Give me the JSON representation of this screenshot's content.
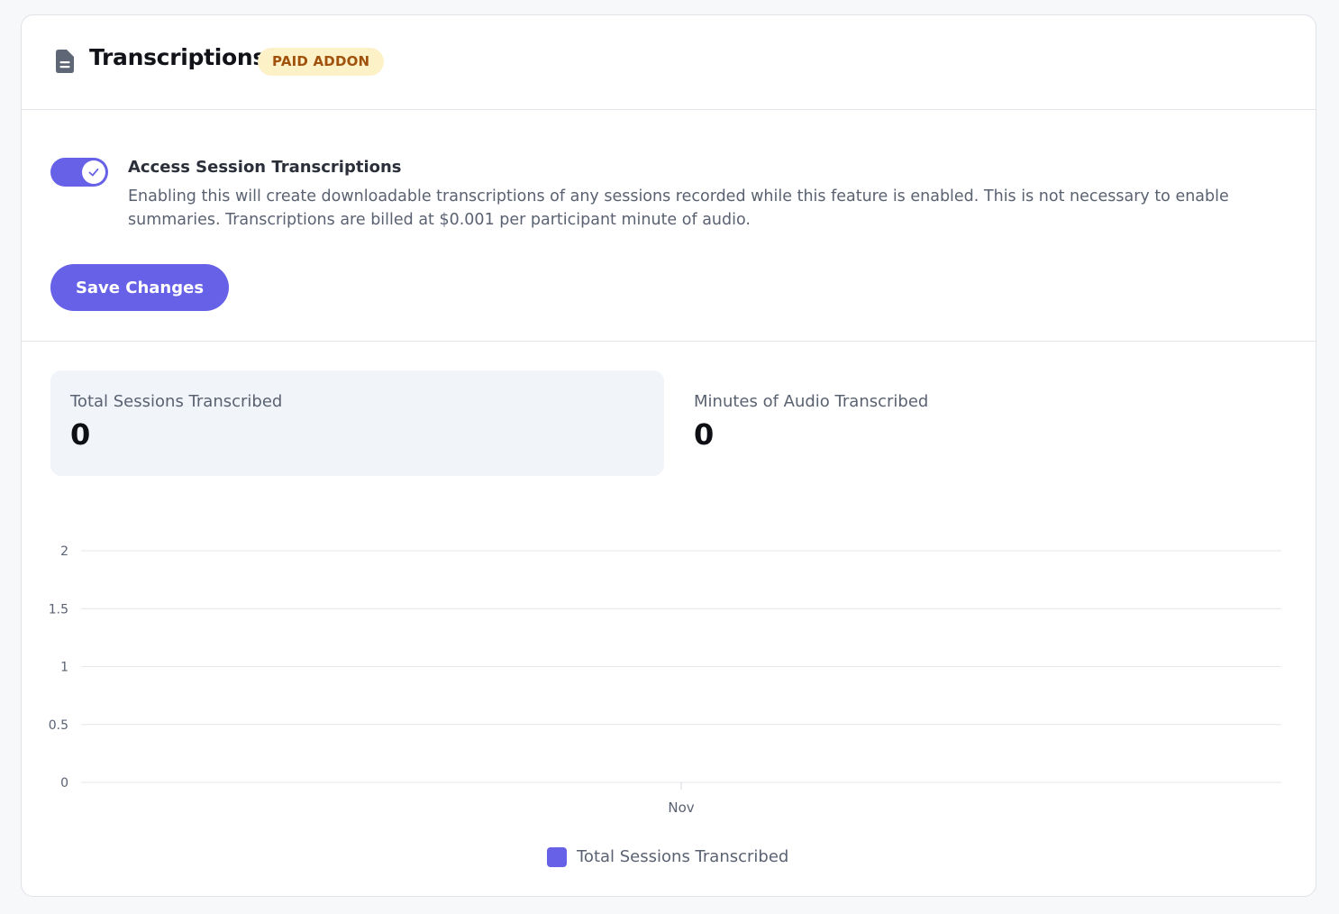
{
  "header": {
    "title": "Transcriptions",
    "badge": "PAID ADDON",
    "icon": "document-icon"
  },
  "setting": {
    "enabled": true,
    "title": "Access Session Transcriptions",
    "description": "Enabling this will create downloadable transcriptions of any sessions recorded while this feature is enabled. This is not necessary to enable summaries. Transcriptions are billed at $0.001 per participant minute of audio."
  },
  "save_label": "Save Changes",
  "stats": [
    {
      "label": "Total Sessions Transcribed",
      "value": "0"
    },
    {
      "label": "Minutes of Audio Transcribed",
      "value": "0"
    }
  ],
  "colors": {
    "accent": "#6661e6",
    "badge_bg": "#fdf1c7",
    "badge_text": "#a0520d"
  },
  "chart_data": {
    "type": "bar",
    "categories": [
      "Nov"
    ],
    "series": [
      {
        "name": "Total Sessions Transcribed",
        "values": [
          0
        ]
      }
    ],
    "y_ticks": [
      "0",
      "0.5",
      "1",
      "1.5",
      "2"
    ],
    "ylim": [
      0,
      2
    ],
    "grid": true,
    "legend": "bottom-center"
  }
}
